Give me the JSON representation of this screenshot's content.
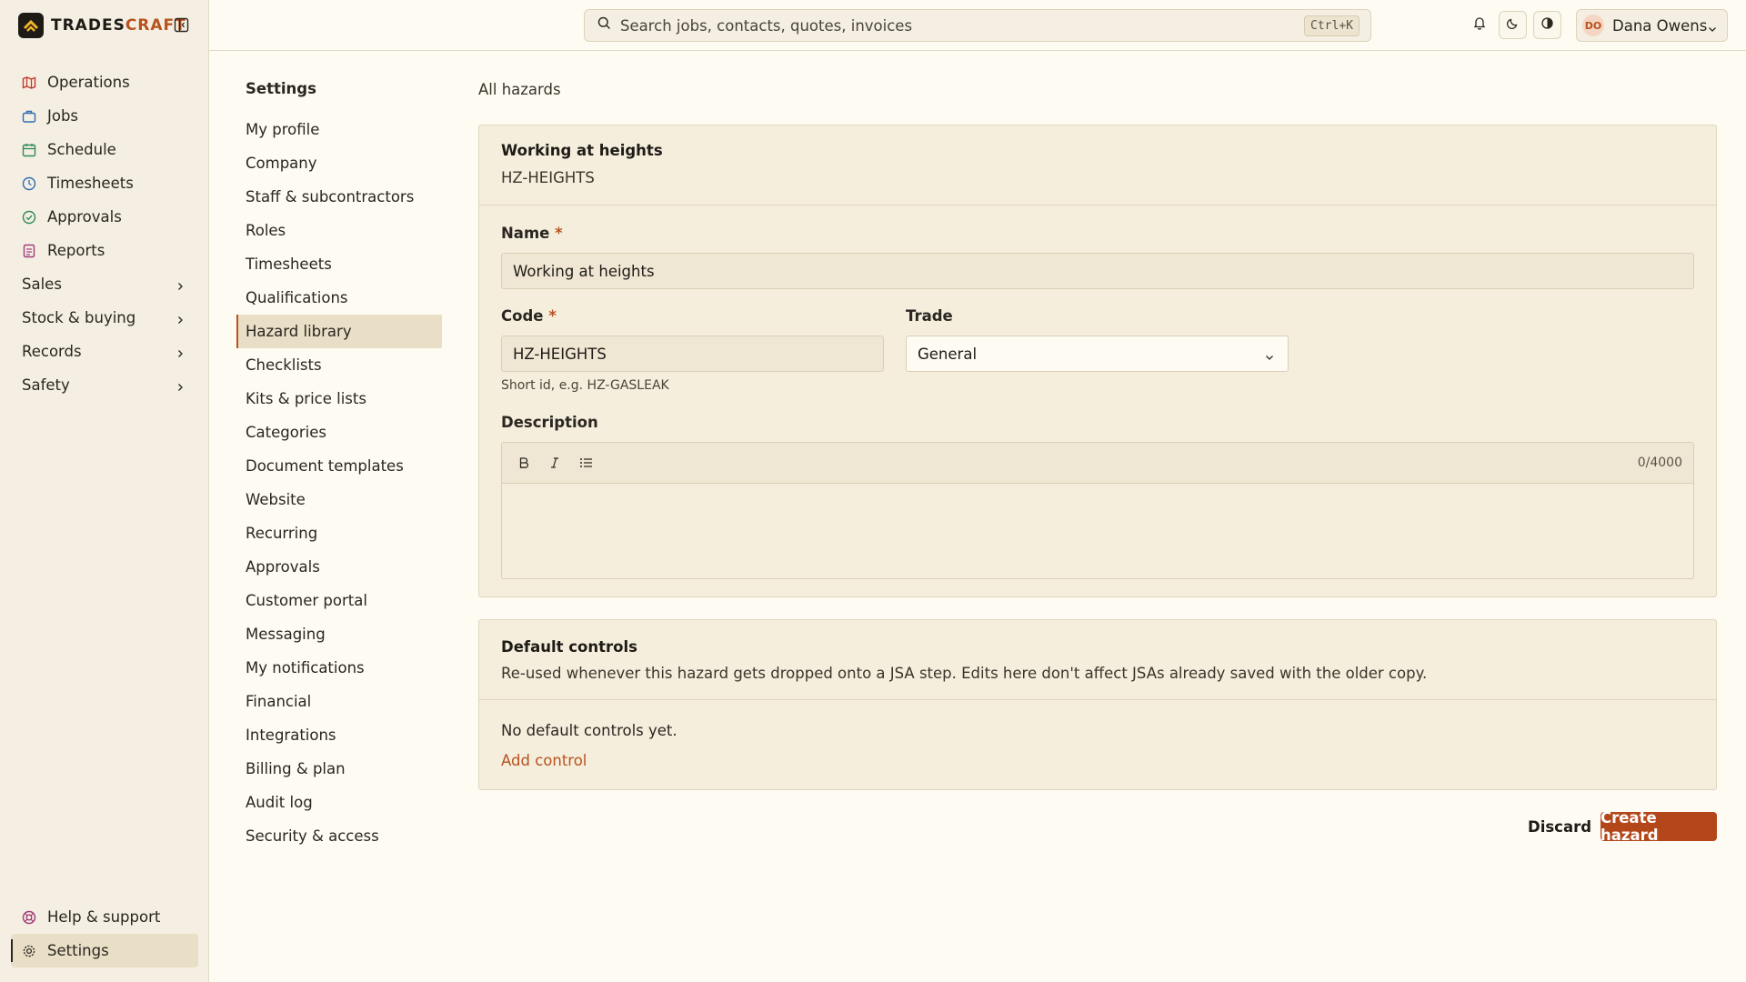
{
  "brand": {
    "name_a": "TRADES",
    "name_b": "CRAFT"
  },
  "sidebar": {
    "items": [
      {
        "label": "Operations",
        "icon": "map-icon",
        "color": "#c0392b"
      },
      {
        "label": "Jobs",
        "icon": "briefcase-icon",
        "color": "#2e6db4"
      },
      {
        "label": "Schedule",
        "icon": "calendar-icon",
        "color": "#2e8b57"
      },
      {
        "label": "Timesheets",
        "icon": "clock-icon",
        "color": "#2e6db4"
      },
      {
        "label": "Approvals",
        "icon": "check-circle-icon",
        "color": "#2e8b57"
      },
      {
        "label": "Reports",
        "icon": "report-icon",
        "color": "#a03a7a"
      }
    ],
    "groups": [
      {
        "label": "Sales"
      },
      {
        "label": "Stock & buying"
      },
      {
        "label": "Records"
      },
      {
        "label": "Safety"
      }
    ],
    "bottom": [
      {
        "label": "Help & support",
        "icon": "lifebuoy-icon"
      },
      {
        "label": "Settings",
        "icon": "gear-icon"
      }
    ]
  },
  "topbar": {
    "search_placeholder": "Search jobs, contacts, quotes, invoices",
    "shortcut": "Ctrl+K",
    "user": {
      "initials": "DO",
      "name": "Dana Owens"
    }
  },
  "settings_nav": {
    "title": "Settings",
    "items": [
      "My profile",
      "Company",
      "Staff & subcontractors",
      "Roles",
      "Timesheets",
      "Qualifications",
      "Hazard library",
      "Checklists",
      "Kits & price lists",
      "Categories",
      "Document templates",
      "Website",
      "Recurring",
      "Approvals",
      "Customer portal",
      "Messaging",
      "My notifications",
      "Financial",
      "Integrations",
      "Billing & plan",
      "Audit log",
      "Security & access"
    ],
    "active": "Hazard library"
  },
  "main": {
    "breadcrumb": "All hazards",
    "hazard": {
      "title": "Working at heights",
      "code_display": "HZ-HEIGHTS",
      "name_label": "Name",
      "name_value": "Working at heights",
      "code_label": "Code",
      "code_value": "HZ-HEIGHTS",
      "code_hint": "Short id, e.g. HZ-GASLEAK",
      "trade_label": "Trade",
      "trade_value": "General",
      "description_label": "Description",
      "char_count": "0/4000",
      "required_mark": "*"
    },
    "controls": {
      "title": "Default controls",
      "description": "Re-used whenever this hazard gets dropped onto a JSA step. Edits here don't affect JSAs already saved with the older copy.",
      "empty": "No default controls yet.",
      "add_link": "Add control"
    },
    "actions": {
      "discard": "Discard",
      "create": "Create hazard"
    }
  }
}
